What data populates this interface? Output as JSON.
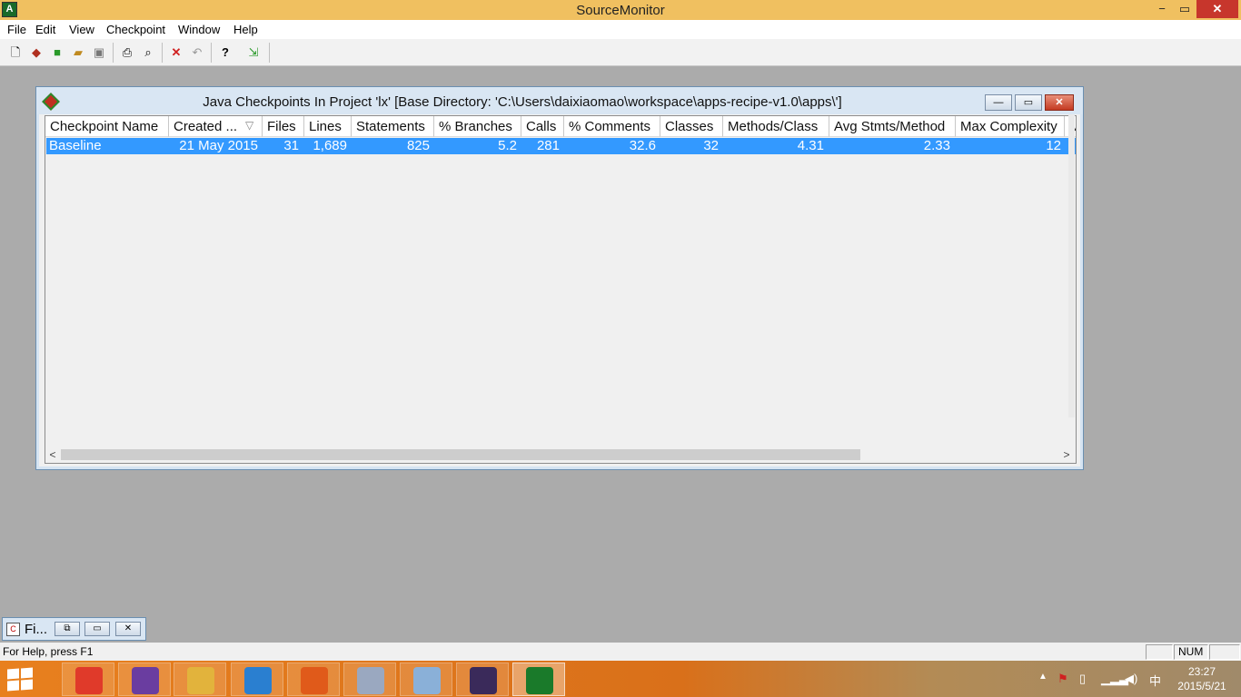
{
  "window": {
    "title": "SourceMonitor",
    "min": "−",
    "max": "▭",
    "close": "✕"
  },
  "menu": [
    "File",
    "Edit",
    "View",
    "Checkpoint",
    "Window",
    "Help"
  ],
  "child": {
    "title": "Java Checkpoints In Project 'lx'  [Base Directory: 'C:\\Users\\daixiaomao\\workspace\\apps-recipe-v1.0\\apps\\']",
    "columns": [
      "Checkpoint Name",
      "Created ...",
      "Files",
      "Lines",
      "Statements",
      "% Branches",
      "Calls",
      "% Comments",
      "Classes",
      "Methods/Class",
      "Avg Stmts/Method",
      "Max Complexity",
      "M"
    ],
    "sort_indicator": "▽",
    "row": [
      "Baseline",
      "21 May 2015",
      "31",
      "1,689",
      "825",
      "5.2",
      "281",
      "32.6",
      "32",
      "4.31",
      "2.33",
      "12"
    ]
  },
  "minimized": {
    "label": "Fi...",
    "icon_text": "C"
  },
  "status": {
    "help": "For Help, press F1",
    "num": "NUM"
  },
  "taskbar": {
    "clock_time": "23:27",
    "clock_date": "2015/5/21",
    "apps": [
      {
        "name": "chrome",
        "color": "#e03a2a"
      },
      {
        "name": "visual-studio",
        "color": "#6a3da0"
      },
      {
        "name": "file-explorer",
        "color": "#e2b33c"
      },
      {
        "name": "messaging",
        "color": "#2a7fd0"
      },
      {
        "name": "powerpoint-like",
        "color": "#e05a1a"
      },
      {
        "name": "paint",
        "color": "#9aa8c0"
      },
      {
        "name": "performance-monitor",
        "color": "#8ab0d8"
      },
      {
        "name": "java-ee-ide",
        "color": "#3a2a5a"
      },
      {
        "name": "sourcemonitor",
        "color": "#1a7a2a"
      }
    ],
    "ime": "中"
  }
}
